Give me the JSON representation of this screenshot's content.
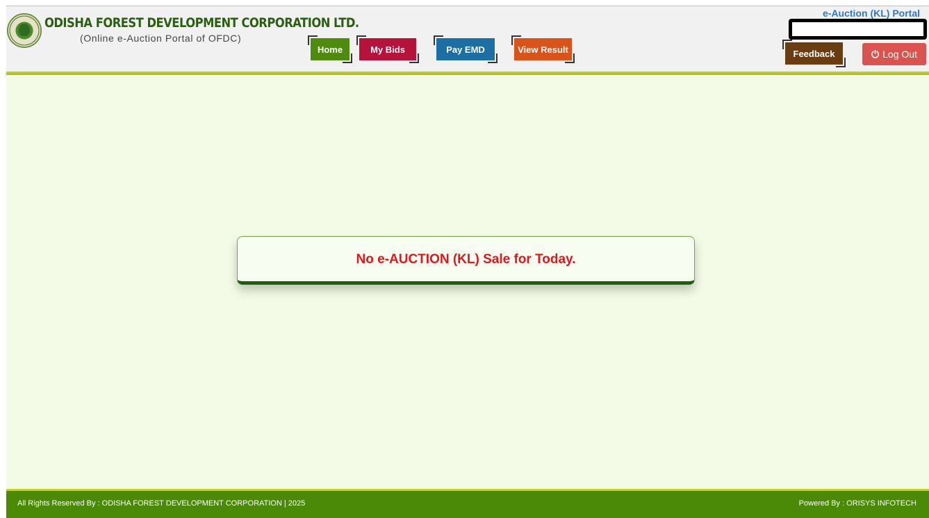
{
  "header": {
    "org_name": "ODISHA FOREST DEVELOPMENT CORPORATION LTD.",
    "org_subtitle": "(Online e-Auction Portal of OFDC)",
    "portal_title": "e-Auction (KL) Portal"
  },
  "nav": {
    "home": "Home",
    "my_bids": "My Bids",
    "pay_emd": "Pay EMD",
    "view_result": "View Result",
    "feedback": "Feedback",
    "logout": "Log Out"
  },
  "icons": {
    "logo": "ofdc-logo-icon",
    "logout": "power-icon"
  },
  "colors": {
    "home": "#4e8b0e",
    "my_bids": "#b5123c",
    "pay_emd": "#1d6fa3",
    "view_result": "#d9541a",
    "feedback": "#6a3d10",
    "logout": "#d9534f",
    "notice_text": "#e0171b",
    "footer": "#4b8a06"
  },
  "main": {
    "notice": "No e-AUCTION (KL) Sale for Today."
  },
  "footer": {
    "copyright": "All Rights Reserved By : ODISHA FOREST DEVELOPMENT CORPORATION | 2025",
    "powered_by": "Powered By :  ORISYS INFOTECH"
  }
}
